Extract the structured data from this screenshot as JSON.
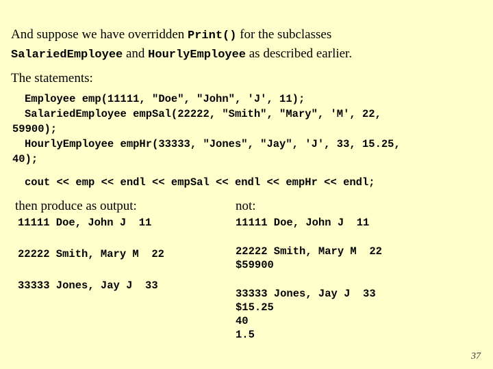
{
  "slide": {
    "background_color": "#ffffcc",
    "text_color": "#000000",
    "page_number": "37"
  },
  "intro": {
    "line1_prefix": "And suppose we have overridden ",
    "line1_code": "Print()",
    "line1_suffix": " for the subclasses",
    "line2_code1": "SalariedEmployee",
    "line2_mid": " and ",
    "line2_code2": "HourlyEmployee",
    "line2_suffix": " as described earlier."
  },
  "statements_heading": "The statements:",
  "code": {
    "lines": [
      "Employee emp(11111, \"Doe\", \"John\", 'J', 11);",
      "SalariedEmployee empSal(22222, \"Smith\", \"Mary\", 'M', 22,",
      "59900);",
      "HourlyEmployee empHr(33333, \"Jones\", \"Jay\", 'J', 33, 15.25,",
      "40);"
    ],
    "cout_line": "cout << emp << endl << empSal << endl << empHr << endl;"
  },
  "left_column": {
    "heading": "then produce as output:",
    "groups": [
      {
        "lines": [
          "11111 Doe, John J  11"
        ]
      },
      {
        "lines": [
          "22222 Smith, Mary M  22"
        ]
      },
      {
        "lines": [
          "33333 Jones, Jay J  33"
        ]
      }
    ]
  },
  "right_column": {
    "heading": "not:",
    "groups": [
      {
        "lines": [
          "11111 Doe, John J  11"
        ]
      },
      {
        "lines": [
          "22222 Smith, Mary M  22",
          "$59900"
        ]
      },
      {
        "lines": [
          "33333 Jones, Jay J  33",
          "$15.25",
          "40",
          "1.5"
        ]
      }
    ]
  }
}
